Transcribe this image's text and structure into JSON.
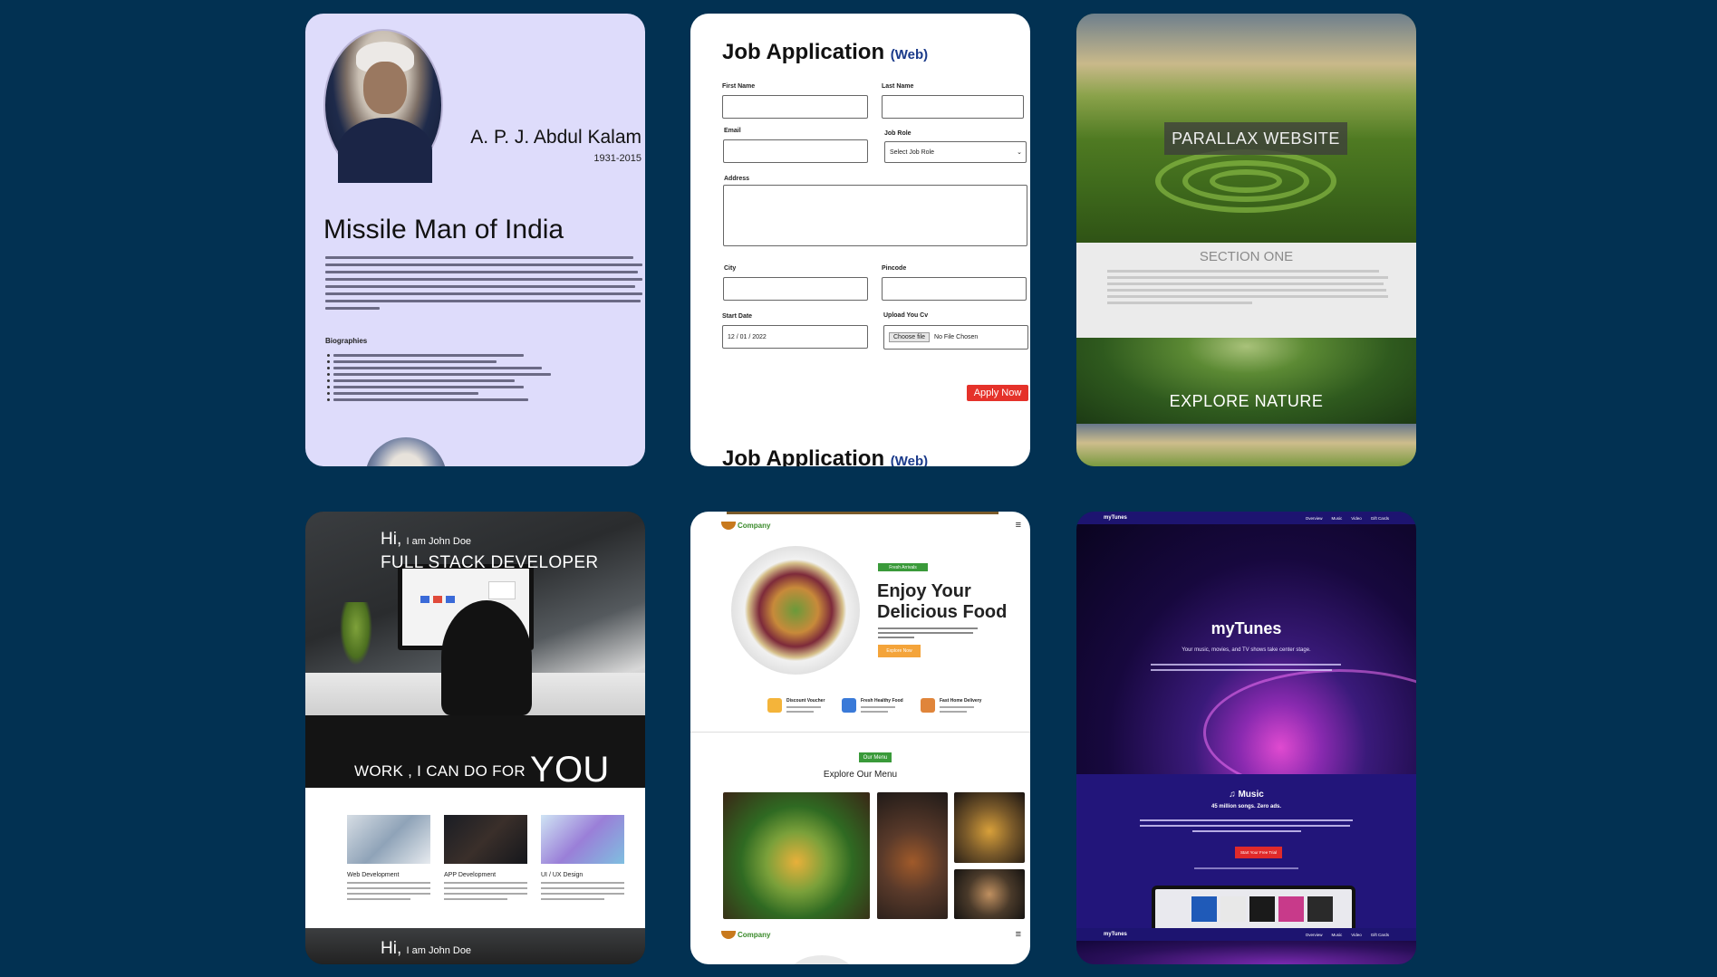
{
  "cards": {
    "kalam": {
      "name": "A. P. J. Abdul Kalam",
      "years": "1931-2015",
      "title": "Missile Man of India",
      "biographies_heading": "Biographies"
    },
    "job": {
      "title": "Job Application",
      "title_tag": "(Web)",
      "labels": {
        "first_name": "First Name",
        "last_name": "Last Name",
        "email": "Email",
        "job_role": "Job Role",
        "address": "Address",
        "city": "City",
        "pincode": "Pincode",
        "start_date": "Start  Date",
        "upload": "Upload You Cv"
      },
      "job_role_value": "Select Job Role",
      "start_date_value": "12 / 01 / 2022",
      "file_button": "Choose file",
      "file_status": "No File Chosen",
      "apply_button": "Apply Now"
    },
    "parallax": {
      "hero_title": "PARALLAX WEBSITE",
      "section_title": "SECTION ONE",
      "nature_title": "EXPLORE NATURE"
    },
    "developer": {
      "hi": "Hi,",
      "intro": "I am John Doe",
      "role": "FULL STACK DEVELOPER",
      "work_text": "WORK , I CAN DO FOR",
      "you": "YOU",
      "services": [
        "Web Development",
        "APP Development",
        "UI / UX Design"
      ]
    },
    "food": {
      "brand": "Company",
      "tag": "Fresh Arrivals",
      "heading": "Enjoy Your Delicious Food",
      "explore_button": "Explore Now",
      "features": [
        "Discount Voucher",
        "Fresh Healthy Food",
        "Fast Home Delivery"
      ],
      "our_menu_tag": "Our Menu",
      "explore_menu": "Explore Our Menu"
    },
    "mytunes": {
      "brand": "myTunes",
      "nav_links": [
        "Overview",
        "Music",
        "Video",
        "Gift Cards"
      ],
      "hero_title": "myTunes",
      "hero_subtitle": "Your music, movies, and TV shows take center stage.",
      "music_title": "♫ Music",
      "music_subtitle": "45 million songs. Zero ads.",
      "trial_button": "Start Your Free Trial"
    }
  },
  "colors": {
    "background": "#023152",
    "apply_red": "#e5322a",
    "food_green": "#3a9a3a",
    "food_orange": "#f4a43a",
    "mytunes_nav": "#1d1470"
  }
}
